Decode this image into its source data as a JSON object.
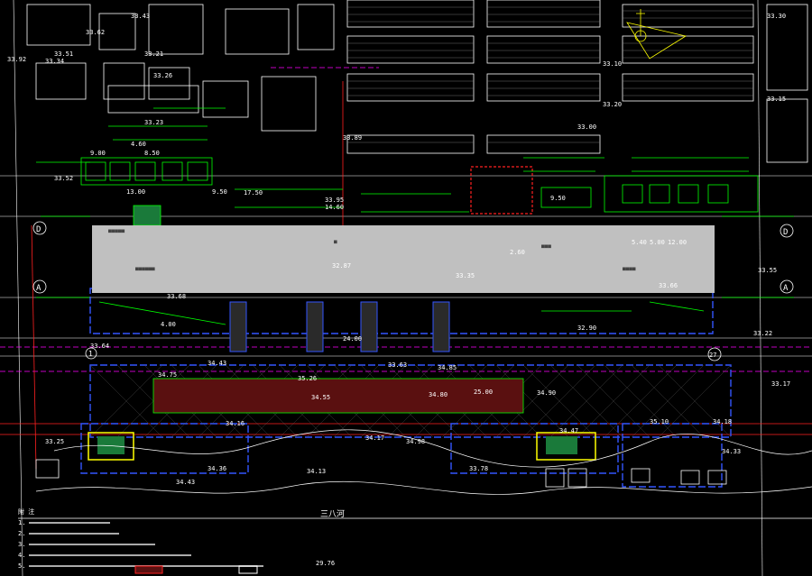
{
  "elevations": [
    "33.43",
    "33.62",
    "33.92",
    "33.51",
    "33.21",
    "33.26",
    "33.23",
    "33.52",
    "33.34",
    "33.64",
    "33.25",
    "33.89",
    "33.00",
    "33.10",
    "33.20",
    "33.30",
    "33.15",
    "33.55",
    "33.68",
    "33.95",
    "34.75",
    "35.26",
    "35.10",
    "34.90",
    "34.85",
    "34.55",
    "34.80",
    "34.17",
    "34.98",
    "34.16",
    "34.13",
    "34.36",
    "34.33",
    "34.18",
    "34.43",
    "33.22",
    "33.17",
    "33.66",
    "33.35",
    "32.87",
    "32.90",
    "34.47",
    "34.43",
    "33.78",
    "33.63",
    "29.76"
  ],
  "dimensions": [
    "4.60",
    "9.00",
    "8.50",
    "13.00",
    "9.50",
    "17.50",
    "14.60",
    "25.00",
    "24.00",
    "12.00",
    "5.40",
    "2.60",
    "5.00",
    "4.00",
    "9.50"
  ],
  "axis_markers": [
    "A",
    "D",
    "1",
    "27"
  ],
  "river_label": "三八河",
  "notes": {
    "title": "附  注",
    "lines": [
      "1.",
      "2.",
      "3.",
      "4.",
      "5."
    ]
  },
  "colors": {
    "background": "#000000",
    "building": "#ffffff",
    "green": "#00ff00",
    "blue": "#3355ff",
    "red": "#ff2020",
    "magenta": "#ff00ff",
    "yellow": "#ffff00",
    "cyan": "#00ffff",
    "station_fill": "#5a1010",
    "redacted": "#c0c0c0"
  }
}
